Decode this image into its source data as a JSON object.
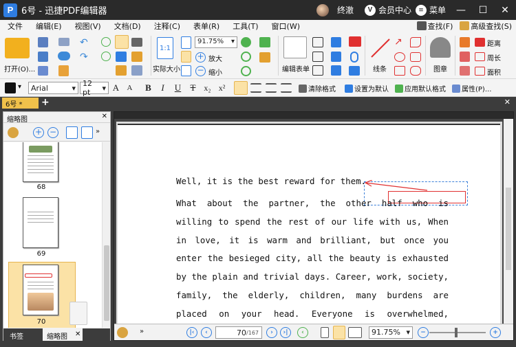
{
  "window": {
    "title": "6号 - 迅捷PDF编辑器",
    "app_logo": "P",
    "user_name": "终澈",
    "vip_badge": "V",
    "member_center": "会员中心",
    "menu_label": "菜单",
    "minimize": "—",
    "maximize": "☐",
    "close": "✕"
  },
  "menubar": {
    "items": [
      "文件",
      "编辑(E)",
      "视图(V)",
      "文档(D)",
      "注释(C)",
      "表单(R)",
      "工具(T)",
      "窗口(W)"
    ],
    "right": [
      "查找(F)",
      "高级查找(S)"
    ]
  },
  "ribbon": {
    "open_label": "打开(O)...",
    "actual_size_label": "实际大小",
    "actual_size_icon": "1:1",
    "zoom_value": "91.75%",
    "zoom_in_label": "放大",
    "zoom_out_label": "缩小",
    "edit_form_label": "编辑表单",
    "line_label": "线条",
    "stamp_label": "图章",
    "distance_label": "距离",
    "perimeter_label": "周长",
    "area_label": "面积"
  },
  "formatbar": {
    "font": "Arial",
    "size": "12 pt",
    "bold": "B",
    "italic": "I",
    "underline": "U",
    "strike": "T",
    "sub": "x₂",
    "sup": "x²",
    "clear_format": "清除格式",
    "set_default": "设置为默认",
    "apply_default": "应用默认格式",
    "properties": "属性(P)..."
  },
  "tabs": {
    "doc_tab": "6号 *",
    "add": "+",
    "close": "✕"
  },
  "sidebar": {
    "title": "缩略图",
    "close": "✕",
    "pages": [
      "68",
      "69",
      "70"
    ],
    "tab_bookmarks": "书签",
    "tab_thumbnails": "缩略图",
    "tab_close": "✕"
  },
  "document": {
    "line1": "Well, it is the best reward for them.",
    "paragraph": [
      "What  about  the  partner,  the  other  half  who  is",
      "willing to spend the rest of our life with us, When",
      "in  love,  it  is  warm  and  brilliant,  but  once  you",
      "enter the besieged city, all the beauty is exhausted",
      "by the plain and trivial days. Career, work, society,",
      "family,  the  elderly,  children,  many  burdens  are",
      "placed  on  your  head.  Everyone  is  overwhelmed,"
    ]
  },
  "statusbar": {
    "current_page": "70",
    "total_pages": "/167",
    "zoom": "91.75%"
  },
  "colors": {
    "accent": "#2f7de1",
    "titlebar": "#2a2a2a",
    "tab_active": "#f0c14b",
    "annotation": "#e03030"
  }
}
